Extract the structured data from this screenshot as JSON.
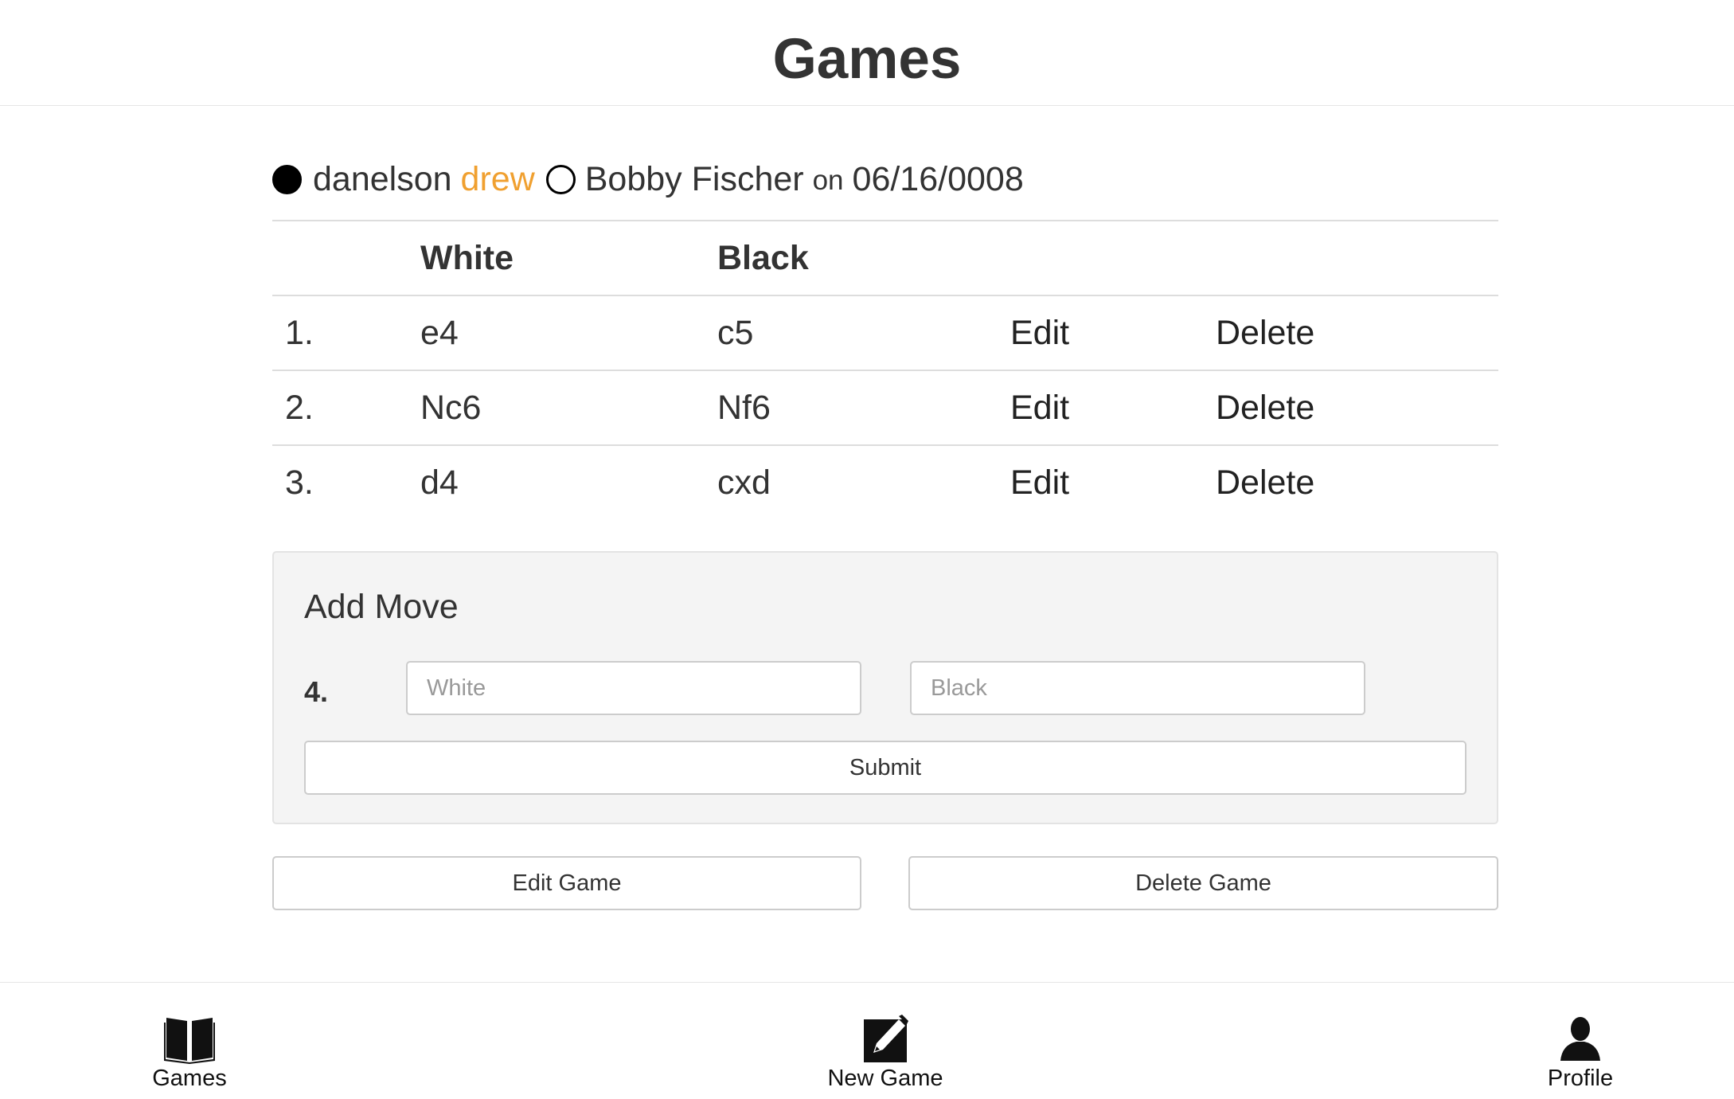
{
  "header": {
    "title": "Games"
  },
  "game": {
    "white_player": "danelson",
    "result": "drew",
    "black_player": "Bobby Fischer",
    "on_word": "on",
    "date": "06/16/0008"
  },
  "table": {
    "headers": {
      "number": "",
      "white": "White",
      "black": "Black"
    },
    "rows": [
      {
        "number": "1.",
        "white": "e4",
        "black": "c5",
        "edit": "Edit",
        "delete": "Delete"
      },
      {
        "number": "2.",
        "white": "Nc6",
        "black": "Nf6",
        "edit": "Edit",
        "delete": "Delete"
      },
      {
        "number": "3.",
        "white": "d4",
        "black": "cxd",
        "edit": "Edit",
        "delete": "Delete"
      }
    ]
  },
  "add_move": {
    "title": "Add Move",
    "move_number": "4.",
    "white_placeholder": "White",
    "black_placeholder": "Black",
    "white_value": "",
    "black_value": "",
    "submit_label": "Submit"
  },
  "actions": {
    "edit_game_label": "Edit Game",
    "delete_game_label": "Delete Game"
  },
  "tabbar": {
    "items": [
      {
        "label": "Games",
        "icon": "open-book-icon"
      },
      {
        "label": "New Game",
        "icon": "compose-icon"
      },
      {
        "label": "Profile",
        "icon": "person-icon"
      }
    ]
  }
}
